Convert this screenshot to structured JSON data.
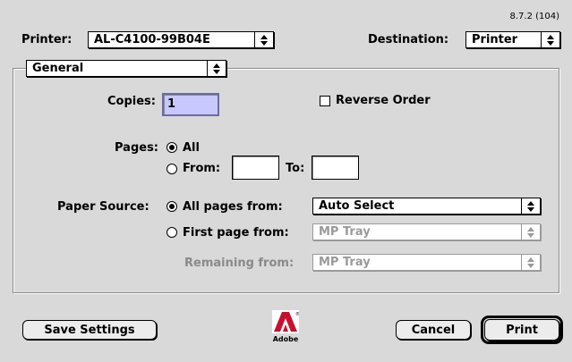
{
  "version": "8.7.2 (104)",
  "printer": {
    "label": "Printer:",
    "value": "AL-C4100-99B04E"
  },
  "destination": {
    "label": "Destination:",
    "value": "Printer"
  },
  "panel": {
    "value": "General"
  },
  "copies": {
    "label": "Copies:",
    "value": "1"
  },
  "reverse_order": {
    "label": "Reverse Order",
    "checked": false
  },
  "pages": {
    "label": "Pages:",
    "all_label": "All",
    "from_label": "From:",
    "to_label": "To:",
    "from_value": "",
    "to_value": "",
    "selected": "All"
  },
  "paper_source": {
    "label": "Paper Source:",
    "all_pages_label": "All pages from:",
    "all_pages_value": "Auto Select",
    "first_page_label": "First page from:",
    "first_page_value": "MP Tray",
    "remaining_label": "Remaining from:",
    "remaining_value": "MP Tray",
    "selected": "All pages from"
  },
  "buttons": {
    "save_settings": "Save Settings",
    "cancel": "Cancel",
    "print": "Print"
  },
  "logo": {
    "word": "Adobe",
    "mark": "A"
  },
  "colors": {
    "background": "#d9d9d9",
    "focus_field": "#c8c8ff",
    "disabled": "#9a9a9a"
  }
}
